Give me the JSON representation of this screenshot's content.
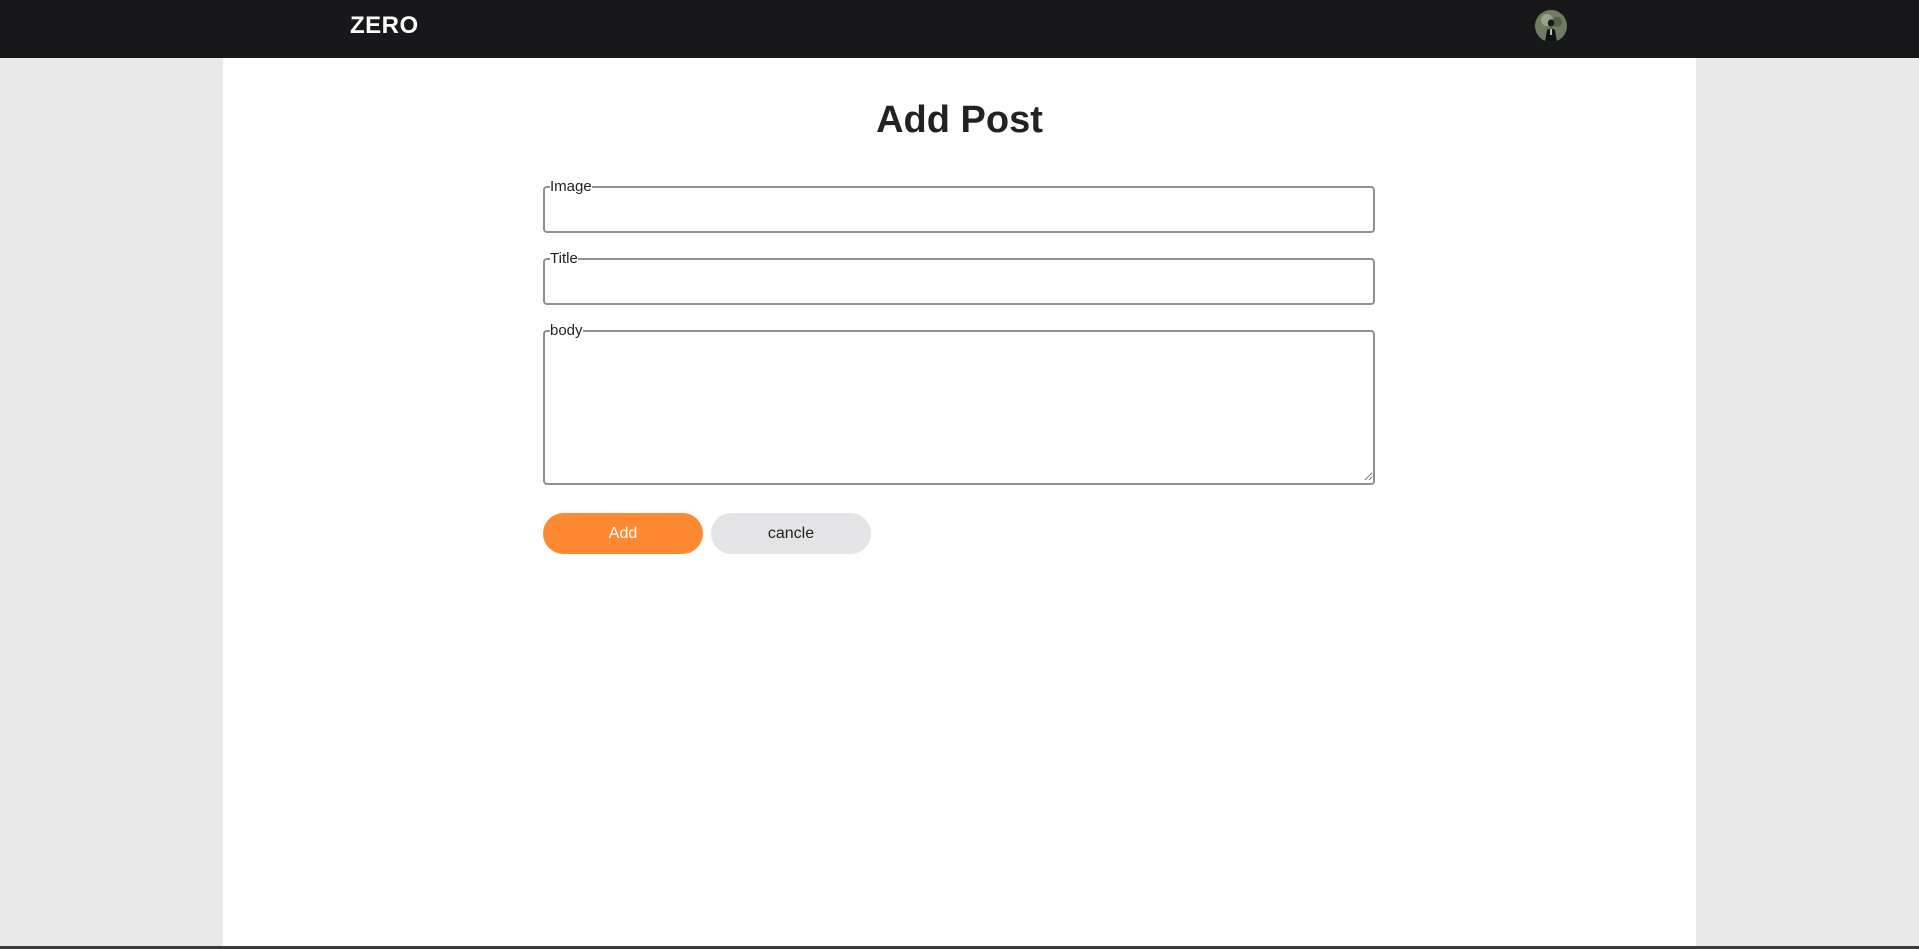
{
  "header": {
    "brand": "ZERO",
    "avatar_icon": "user-avatar-icon"
  },
  "main": {
    "title": "Add Post",
    "fields": {
      "image": {
        "label": "Image",
        "value": ""
      },
      "title": {
        "label": "Title",
        "value": ""
      },
      "body": {
        "label": "body",
        "value": ""
      }
    },
    "buttons": {
      "add": "Add",
      "cancel": "cancle"
    }
  },
  "colors": {
    "topbar": "#18181a",
    "accent": "#fd8932",
    "secondary_button": "#e4e4e6",
    "page_background": "#e9e9e9",
    "panel_background": "#ffffff"
  }
}
